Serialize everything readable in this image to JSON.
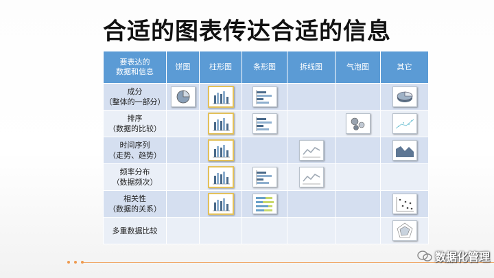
{
  "title": "合适的图表传达合适的信息",
  "header": {
    "corner_line1": "要表达的",
    "corner_line2": "数据和信息",
    "columns": [
      "饼图",
      "柱形图",
      "条形图",
      "拆线图",
      "气泡图",
      "其它"
    ]
  },
  "rows": [
    {
      "label_line1": "成分",
      "label_line2": "（整体的一部分）",
      "cells": [
        "pie-chart-icon",
        "column-chart-icon",
        "bar-chart-icon",
        "",
        "",
        "pie-3d-icon"
      ]
    },
    {
      "label_line1": "排序",
      "label_line2": "（数据的比较）",
      "cells": [
        "",
        "column-chart-icon",
        "bar-chart-icon",
        "",
        "bubble-chart-icon",
        "scatter-line-icon"
      ]
    },
    {
      "label_line1": "时间序列",
      "label_line2": "（走势、趋势）",
      "cells": [
        "",
        "column-chart-icon",
        "",
        "line-chart-icon",
        "",
        "area-chart-icon"
      ]
    },
    {
      "label_line1": "频率分布",
      "label_line2": "（数据频次）",
      "cells": [
        "",
        "column-chart-icon",
        "bar-chart-icon",
        "line-chart-icon",
        "",
        ""
      ]
    },
    {
      "label_line1": "相关性",
      "label_line2": "（数据的关系）",
      "cells": [
        "",
        "column-chart-icon",
        "stacked-bar-icon",
        "",
        "",
        "scatter-chart-icon"
      ]
    },
    {
      "label_line1": "多重数据比较",
      "label_line2": "",
      "cells": [
        "",
        "",
        "",
        "",
        "",
        "radar-chart-icon"
      ]
    }
  ],
  "watermark": {
    "text": "数据化管理"
  },
  "colors": {
    "header": "#5b9bd5",
    "row_dark": "#d5dff0",
    "row_light": "#eaeff7",
    "highlight": "#e3c15a",
    "accent_line": "#f0a868"
  }
}
